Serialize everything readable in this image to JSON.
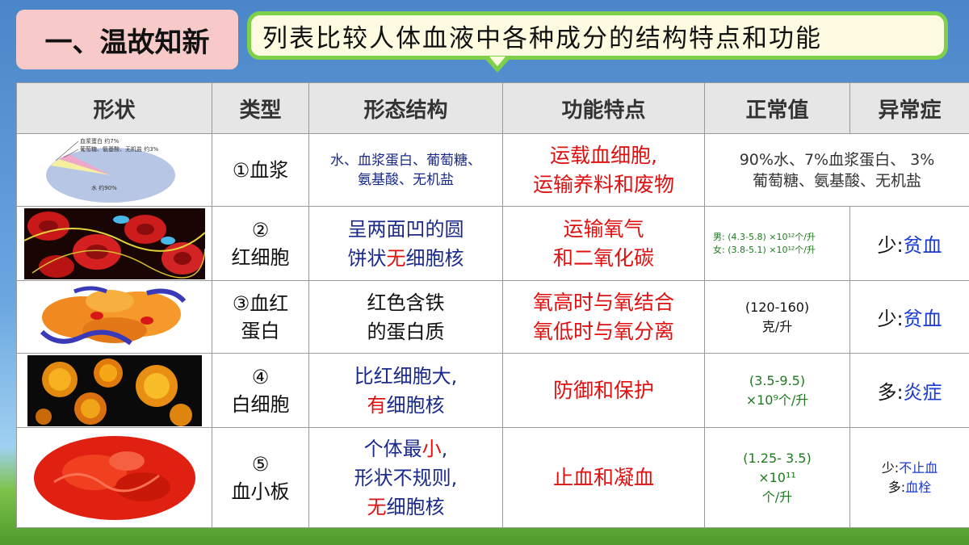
{
  "header": {
    "badge": "一、温故知新",
    "subtitle": "列表比较人体血液中各种成分的结构特点和功能"
  },
  "columns": [
    "形状",
    "类型",
    "形态结构",
    "功能特点",
    "正常值",
    "异常症"
  ],
  "pie": {
    "labels": [
      "血浆蛋白 约7%",
      "葡萄糖、氨基酸、无机盐 约3%",
      "水 约90%"
    ]
  },
  "rows": [
    {
      "type_line1": "①血浆",
      "type_line2": "",
      "morph": [
        "水、血浆蛋白、葡萄糖、",
        "氨基酸、无机盐"
      ],
      "func": [
        "运载血细胞,",
        "运输养料和废物"
      ],
      "normal": [
        "90%水、7%血浆蛋白、 3%",
        "葡萄糖、氨基酸、无机盐"
      ],
      "abnormal": null
    },
    {
      "type_line1": "②",
      "type_line2": "红细胞",
      "morph_a": "呈两面凹的圆",
      "morph_b1": "饼状",
      "morph_b2": "无",
      "morph_b3": "细胞核",
      "func": [
        "运输氧气",
        "和二氧化碳"
      ],
      "normal": [
        "男: (4.3-5.8) ×10¹²个/升",
        "女: (3.8-5.1) ×10¹²个/升"
      ],
      "abnormal": {
        "prefix": "少:",
        "name": "贫血"
      }
    },
    {
      "type_line1": "③血红",
      "type_line2": "蛋白",
      "morph": [
        "红色含铁",
        "的蛋白质"
      ],
      "func": [
        "氧高时与氧结合",
        "氧低时与氧分离"
      ],
      "normal": [
        "(120-160)",
        "克/升"
      ],
      "abnormal": {
        "prefix": "少:",
        "name": "贫血"
      }
    },
    {
      "type_line1": "④",
      "type_line2": "白细胞",
      "morph_a": "比红细胞大,",
      "morph_b1": "有",
      "morph_b2": "细胞核",
      "func": [
        "防御和保护"
      ],
      "normal": [
        "(3.5-9.5)",
        "×10⁹个/升"
      ],
      "abnormal": {
        "prefix": "多:",
        "name": "炎症"
      }
    },
    {
      "type_line1": "⑤",
      "type_line2": "血小板",
      "morph_a1": "个体最",
      "morph_a2": "小",
      "morph_a3": ",",
      "morph_b": "形状不规则,",
      "morph_c1": "无",
      "morph_c2": "细胞核",
      "func": [
        "止血和凝血"
      ],
      "normal": [
        "(1.25- 3.5)",
        "×10¹¹",
        "个/升"
      ],
      "abnormal_small": [
        {
          "prefix": "少:",
          "name": "不止血"
        },
        {
          "prefix": "多:",
          "name": "血栓"
        }
      ]
    }
  ]
}
